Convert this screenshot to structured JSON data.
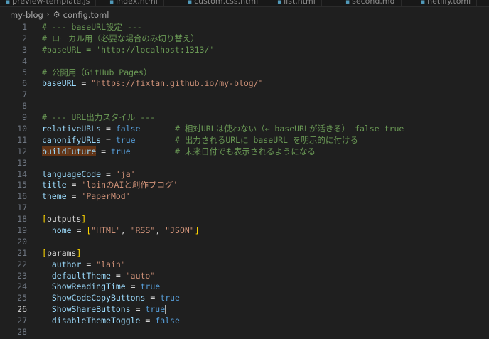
{
  "tabs": [
    {
      "label": "preview-template.js"
    },
    {
      "label": "index.html"
    },
    {
      "label": "custom.css.html"
    },
    {
      "label": "list.html"
    },
    {
      "label": "second.md"
    },
    {
      "label": "netlify.toml"
    }
  ],
  "breadcrumb": {
    "folder": "my-blog",
    "file": "config.toml"
  },
  "editor": {
    "current_line": 26,
    "lines": [
      {
        "n": "1",
        "t": [
          {
            "c": "c",
            "v": "# --- baseURL設定 ---"
          }
        ]
      },
      {
        "n": "2",
        "t": [
          {
            "c": "c",
            "v": "# ローカル用（必要な場合のみ切り替え）"
          }
        ]
      },
      {
        "n": "3",
        "t": [
          {
            "c": "c",
            "v": "#baseURL = 'http://localhost:1313/'"
          }
        ]
      },
      {
        "n": "4",
        "t": []
      },
      {
        "n": "5",
        "t": [
          {
            "c": "c",
            "v": "# 公開用（GitHub Pages）"
          }
        ]
      },
      {
        "n": "6",
        "t": [
          {
            "c": "k",
            "v": "baseURL"
          },
          {
            "c": "o",
            "v": " = "
          },
          {
            "c": "s",
            "v": "\"https://fixtan.github.io/my-blog/\""
          }
        ]
      },
      {
        "n": "7",
        "t": []
      },
      {
        "n": "8",
        "t": []
      },
      {
        "n": "9",
        "t": [
          {
            "c": "c",
            "v": "# --- URL出力スタイル ---"
          }
        ]
      },
      {
        "n": "10",
        "t": [
          {
            "c": "k",
            "v": "relativeURLs"
          },
          {
            "c": "o",
            "v": " = "
          },
          {
            "c": "b",
            "v": "false"
          },
          {
            "c": "o",
            "v": "       "
          },
          {
            "c": "c",
            "v": "# 相対URLは使わない（← baseURLが活きる） false true"
          }
        ]
      },
      {
        "n": "11",
        "t": [
          {
            "c": "k",
            "v": "canonifyURLs"
          },
          {
            "c": "o",
            "v": " = "
          },
          {
            "c": "b",
            "v": "true"
          },
          {
            "c": "o",
            "v": "        "
          },
          {
            "c": "c",
            "v": "# 出力されるURLに baseURL を明示的に付ける"
          }
        ]
      },
      {
        "n": "12",
        "t": [
          {
            "c": "k hl",
            "v": "buildFuture"
          },
          {
            "c": "o",
            "v": " = "
          },
          {
            "c": "b",
            "v": "true"
          },
          {
            "c": "o",
            "v": "         "
          },
          {
            "c": "c",
            "v": "# 未来日付でも表示されるようになる"
          }
        ]
      },
      {
        "n": "13",
        "t": []
      },
      {
        "n": "14",
        "t": [
          {
            "c": "k",
            "v": "languageCode"
          },
          {
            "c": "o",
            "v": " = "
          },
          {
            "c": "s",
            "v": "'ja'"
          }
        ]
      },
      {
        "n": "15",
        "t": [
          {
            "c": "k",
            "v": "title"
          },
          {
            "c": "o",
            "v": " = "
          },
          {
            "c": "s",
            "v": "'lainのAIと創作ブログ'"
          }
        ]
      },
      {
        "n": "16",
        "t": [
          {
            "c": "k",
            "v": "theme"
          },
          {
            "c": "o",
            "v": " = "
          },
          {
            "c": "s",
            "v": "'PaperMod'"
          }
        ]
      },
      {
        "n": "17",
        "t": []
      },
      {
        "n": "18",
        "t": [
          {
            "c": "br2",
            "v": "["
          },
          {
            "c": "sec",
            "v": "outputs"
          },
          {
            "c": "br2",
            "v": "]"
          }
        ]
      },
      {
        "n": "19",
        "t": [
          {
            "c": "o",
            "v": "  "
          },
          {
            "c": "k",
            "v": "home"
          },
          {
            "c": "o",
            "v": " = "
          },
          {
            "c": "br2",
            "v": "["
          },
          {
            "c": "s",
            "v": "\"HTML\""
          },
          {
            "c": "o",
            "v": ", "
          },
          {
            "c": "s",
            "v": "\"RSS\""
          },
          {
            "c": "o",
            "v": ", "
          },
          {
            "c": "s",
            "v": "\"JSON\""
          },
          {
            "c": "br2",
            "v": "]"
          }
        ]
      },
      {
        "n": "20",
        "t": []
      },
      {
        "n": "21",
        "t": [
          {
            "c": "br2",
            "v": "["
          },
          {
            "c": "sec",
            "v": "params"
          },
          {
            "c": "br2",
            "v": "]"
          }
        ]
      },
      {
        "n": "22",
        "t": [
          {
            "c": "o",
            "v": "  "
          },
          {
            "c": "k",
            "v": "author"
          },
          {
            "c": "o",
            "v": " = "
          },
          {
            "c": "s",
            "v": "\"lain\""
          }
        ]
      },
      {
        "n": "23",
        "t": [
          {
            "c": "o",
            "v": "  "
          },
          {
            "c": "k",
            "v": "defaultTheme"
          },
          {
            "c": "o",
            "v": " = "
          },
          {
            "c": "s",
            "v": "\"auto\""
          }
        ]
      },
      {
        "n": "24",
        "t": [
          {
            "c": "o",
            "v": "  "
          },
          {
            "c": "k",
            "v": "ShowReadingTime"
          },
          {
            "c": "o",
            "v": " = "
          },
          {
            "c": "b",
            "v": "true"
          }
        ]
      },
      {
        "n": "25",
        "t": [
          {
            "c": "o",
            "v": "  "
          },
          {
            "c": "k",
            "v": "ShowCodeCopyButtons"
          },
          {
            "c": "o",
            "v": " = "
          },
          {
            "c": "b",
            "v": "true"
          }
        ]
      },
      {
        "n": "26",
        "t": [
          {
            "c": "o",
            "v": "  "
          },
          {
            "c": "k",
            "v": "ShowShareButtons"
          },
          {
            "c": "o",
            "v": " = "
          },
          {
            "c": "b",
            "v": "true"
          },
          {
            "c": "cursor",
            "v": ""
          }
        ]
      },
      {
        "n": "27",
        "t": [
          {
            "c": "o",
            "v": "  "
          },
          {
            "c": "k",
            "v": "disableThemeToggle"
          },
          {
            "c": "o",
            "v": " = "
          },
          {
            "c": "b",
            "v": "false"
          }
        ]
      },
      {
        "n": "28",
        "t": []
      }
    ]
  }
}
